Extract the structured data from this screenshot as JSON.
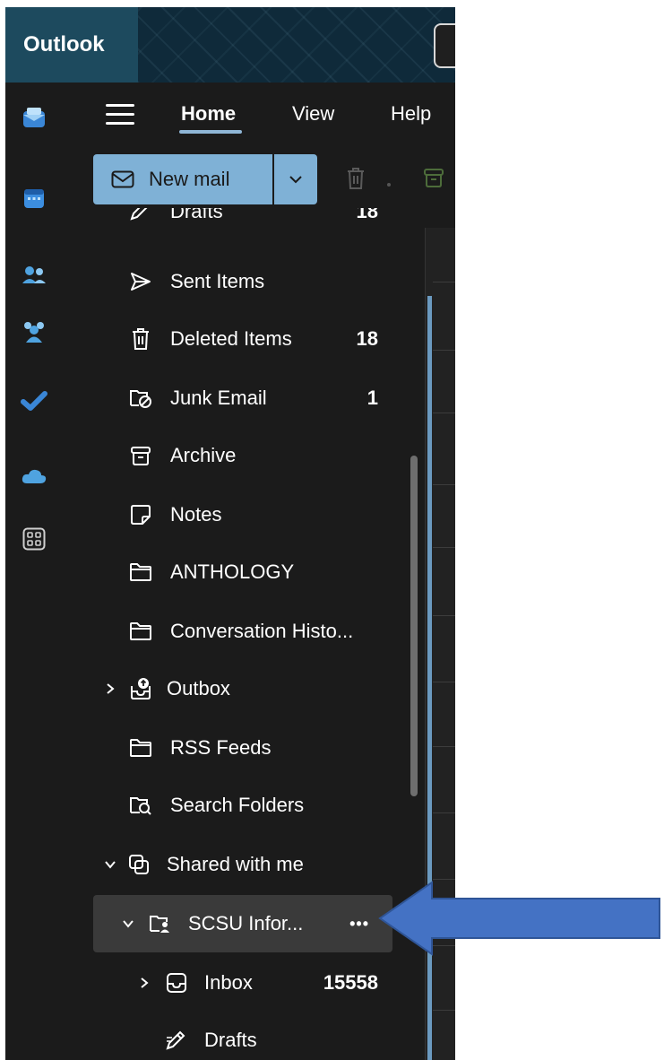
{
  "app": {
    "brand": "Outlook"
  },
  "rail": {
    "items": [
      {
        "name": "mail",
        "color": "#4fa3e0"
      },
      {
        "name": "calendar",
        "color": "#3c8ee0"
      },
      {
        "name": "people",
        "color": "#4fa3e0"
      },
      {
        "name": "groups",
        "color": "#4fa3e0"
      },
      {
        "name": "todo",
        "color": "#3a86d6"
      },
      {
        "name": "onedrive",
        "color": "#4fa3e0"
      },
      {
        "name": "apps",
        "color": "#cfcfcf"
      }
    ]
  },
  "tabs": [
    {
      "label": "Home",
      "active": true
    },
    {
      "label": "View",
      "active": false
    },
    {
      "label": "Help",
      "active": false
    }
  ],
  "toolbar": {
    "new_mail_label": "New mail"
  },
  "folders": [
    {
      "label": "Drafts",
      "count": "18"
    },
    {
      "label": "Sent Items",
      "count": ""
    },
    {
      "label": "Deleted Items",
      "count": "18"
    },
    {
      "label": "Junk Email",
      "count": "1"
    },
    {
      "label": "Archive",
      "count": ""
    },
    {
      "label": "Notes",
      "count": ""
    },
    {
      "label": "ANTHOLOGY",
      "count": ""
    },
    {
      "label": "Conversation Histo...",
      "count": ""
    },
    {
      "label": "Outbox",
      "count": ""
    },
    {
      "label": "RSS Feeds",
      "count": ""
    },
    {
      "label": "Search Folders",
      "count": ""
    },
    {
      "label": "Shared with me",
      "count": ""
    },
    {
      "label": "SCSU Infor...",
      "count": ""
    },
    {
      "label": "Inbox",
      "count": "15558"
    },
    {
      "label": "Drafts",
      "count": ""
    }
  ],
  "more_actions": "•••",
  "colors": {
    "accent": "#7fb1d6",
    "arrow": "#4472c4"
  }
}
